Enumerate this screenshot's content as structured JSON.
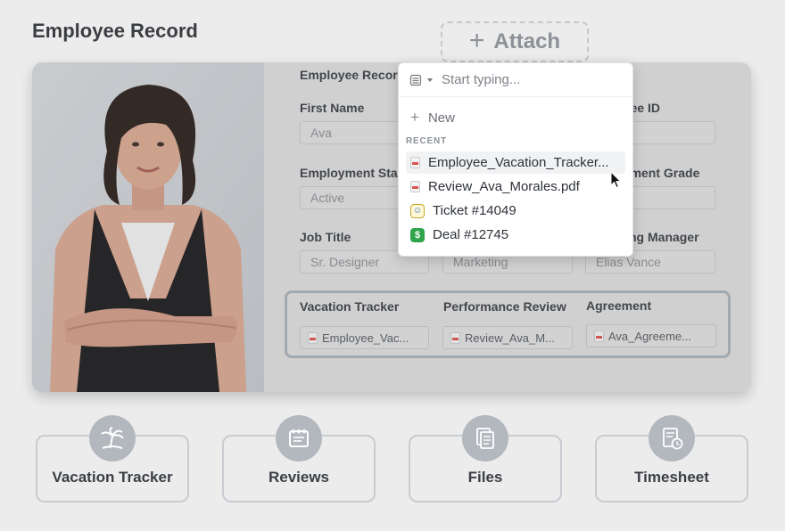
{
  "page": {
    "title": "Employee Record"
  },
  "attach": {
    "label": "Attach"
  },
  "form": {
    "section_label": "Employee Record",
    "fields": {
      "first_name": {
        "label": "First Name",
        "value": "Ava"
      },
      "employee_id": {
        "label": "Employee ID",
        "value": ""
      },
      "employment_status": {
        "label": "Employment Status",
        "value": "Active"
      },
      "employment_grade": {
        "label": "Employment Grade",
        "value": ""
      },
      "job_title": {
        "label": "Job Title",
        "value": "Sr. Designer"
      },
      "department": {
        "label": "",
        "value": "Marketing"
      },
      "reporting_manager": {
        "label": "Reporting Manager",
        "value": "Elias Vance"
      }
    },
    "attachments": {
      "vacation": {
        "label": "Vacation Tracker",
        "file": "Employee_Vac..."
      },
      "performance": {
        "label": "Performance Review",
        "file": "Review_Ava_M..."
      },
      "agreement": {
        "label": "Agreement",
        "file": "Ava_Agreeme..."
      }
    }
  },
  "dropdown": {
    "search_placeholder": "Start typing...",
    "new_label": "New",
    "section_label": "RECENT",
    "items": [
      {
        "label": "Employee_Vacation_Tracker...",
        "icon": "pdf-icon"
      },
      {
        "label": "Review_Ava_Morales.pdf",
        "icon": "pdf-icon"
      },
      {
        "label": "Ticket #14049",
        "icon": "ticket-icon"
      },
      {
        "label": "Deal #12745",
        "icon": "deal-icon"
      }
    ]
  },
  "tiles": [
    {
      "label": "Vacation Tracker",
      "icon": "palm-tree-icon"
    },
    {
      "label": "Reviews",
      "icon": "review-icon"
    },
    {
      "label": "Files",
      "icon": "files-icon"
    },
    {
      "label": "Timesheet",
      "icon": "timesheet-icon"
    }
  ],
  "colors": {
    "background": "#ececec",
    "accent_red": "#d9534f",
    "deal_green": "#2fa44a",
    "icon_circle": "#b3b8bf"
  }
}
